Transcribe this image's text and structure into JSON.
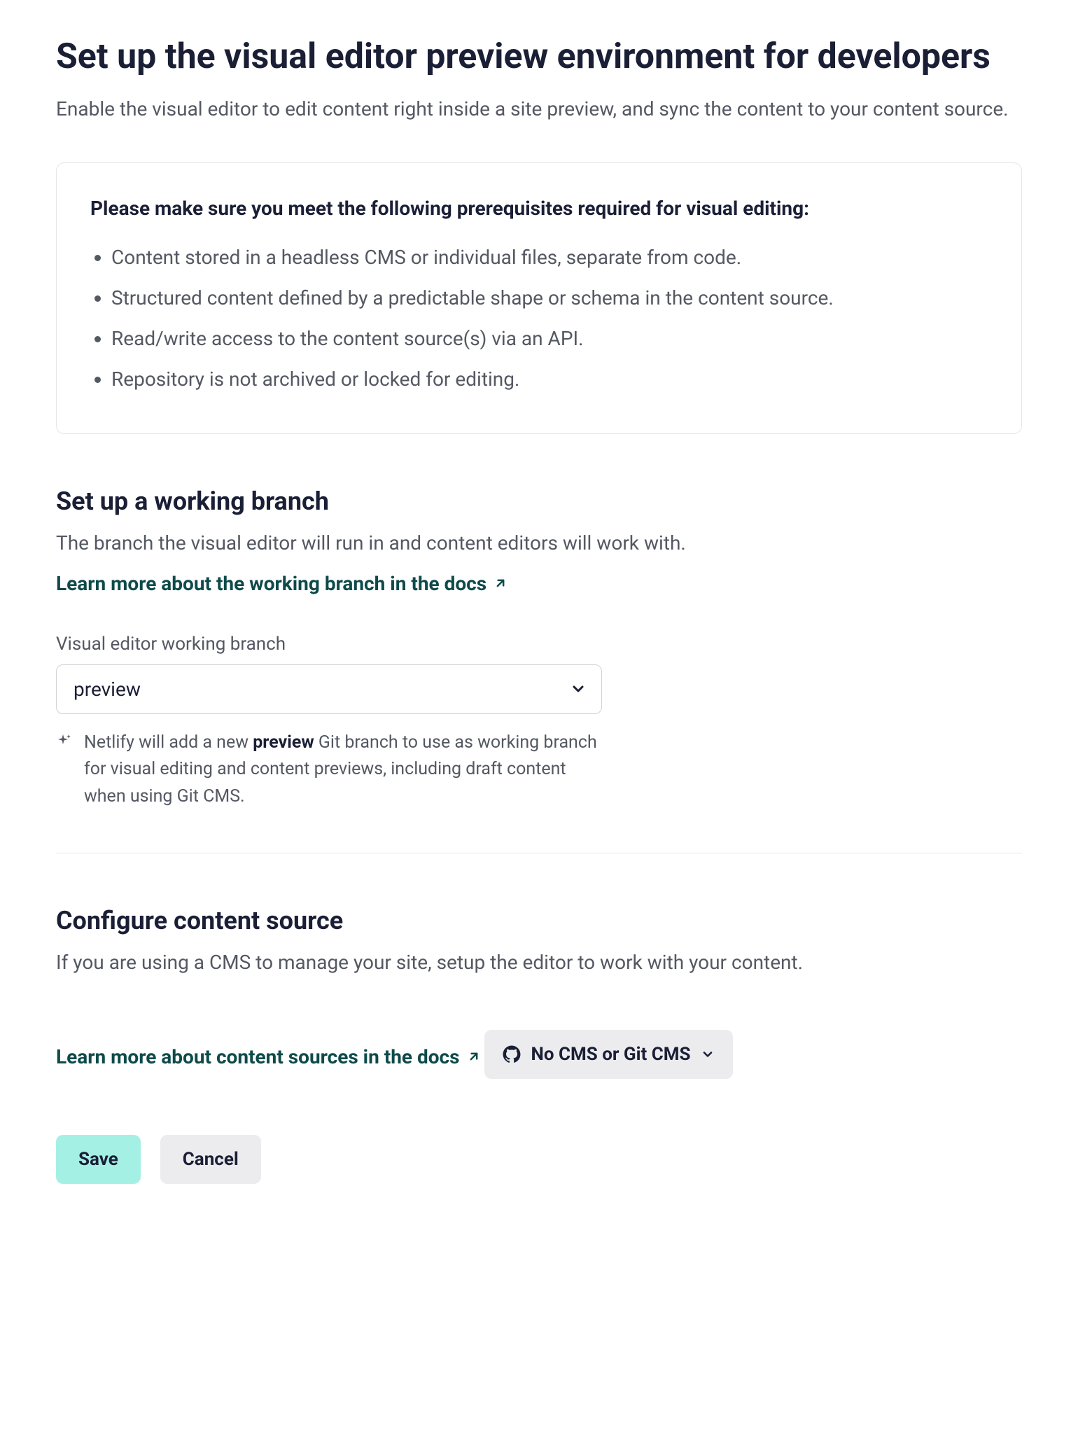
{
  "header": {
    "title": "Set up the visual editor preview environment for developers",
    "subtitle": "Enable the visual editor to edit content right inside a site preview, and sync the content to your content source."
  },
  "prerequisites": {
    "heading": "Please make sure you meet the following prerequisites required for visual editing:",
    "items": [
      "Content stored in a headless CMS or individual files, separate from code.",
      "Structured content defined by a predictable shape or schema in the content source.",
      "Read/write access to the content source(s) via an API.",
      "Repository is not archived or locked for editing."
    ]
  },
  "branch_section": {
    "title": "Set up a working branch",
    "description": "The branch the visual editor will run in and content editors will work with.",
    "link_text": "Learn more about the working branch in the docs",
    "field_label": "Visual editor working branch",
    "selected_value": "preview",
    "helper_prefix": "Netlify will add a new ",
    "helper_strong": "preview",
    "helper_suffix": " Git branch to use as working branch for visual editing and content previews, including draft content when using Git CMS."
  },
  "content_source_section": {
    "title": "Configure content source",
    "description": "If you are using a CMS to manage your site, setup the editor to work with your content.",
    "link_text": "Learn more about content sources in the docs",
    "cms_button_label": "No CMS or Git CMS"
  },
  "actions": {
    "save_label": "Save",
    "cancel_label": "Cancel"
  }
}
